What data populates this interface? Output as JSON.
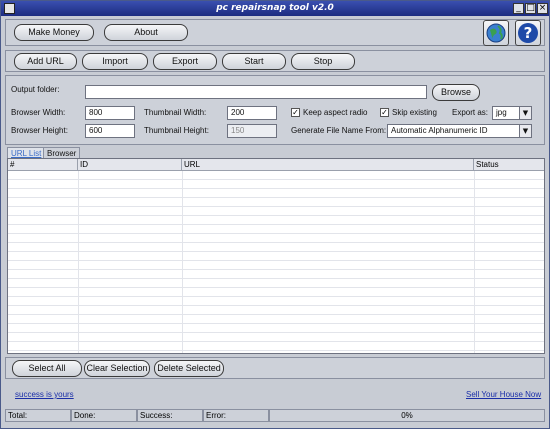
{
  "window": {
    "title": "pc repairsnap tool v2.0"
  },
  "topbar": {
    "make_money": "Make Money",
    "about": "About"
  },
  "toolbar": {
    "add_url": "Add URL",
    "import": "Import",
    "export": "Export",
    "start": "Start",
    "stop": "Stop"
  },
  "settings": {
    "output_folder_label": "Output folder:",
    "output_folder_value": "",
    "browse": "Browse",
    "browser_width_label": "Browser Width:",
    "browser_width_value": "800",
    "browser_height_label": "Browser Height:",
    "browser_height_value": "600",
    "thumb_width_label": "Thumbnail Width:",
    "thumb_width_value": "200",
    "thumb_height_label": "Thumbnail Height:",
    "thumb_height_value": "150",
    "keep_aspect_label": "Keep aspect radio",
    "keep_aspect_checked": true,
    "skip_existing_label": "Skip existing",
    "skip_existing_checked": true,
    "export_as_label": "Export as:",
    "export_as_value": "jpg",
    "gen_name_label": "Generate File Name From:",
    "gen_name_value": "Automatic Alphanumeric ID"
  },
  "tabs": [
    {
      "label": "URL List"
    },
    {
      "label": "Browser"
    }
  ],
  "table": {
    "columns": [
      "#",
      "ID",
      "URL",
      "Status"
    ],
    "rows": []
  },
  "actions": {
    "select_all": "Select All",
    "clear_selection": "Clear Selection",
    "delete_selected": "Delete Selected"
  },
  "links": {
    "left": "success is yours",
    "right": "Sell Your House Now"
  },
  "statusbar": {
    "total": "Total:",
    "done": "Done:",
    "success": "Success:",
    "error": "Error:",
    "progress": "0%"
  },
  "icons": {
    "globe": "globe-icon",
    "help": "help-icon"
  }
}
